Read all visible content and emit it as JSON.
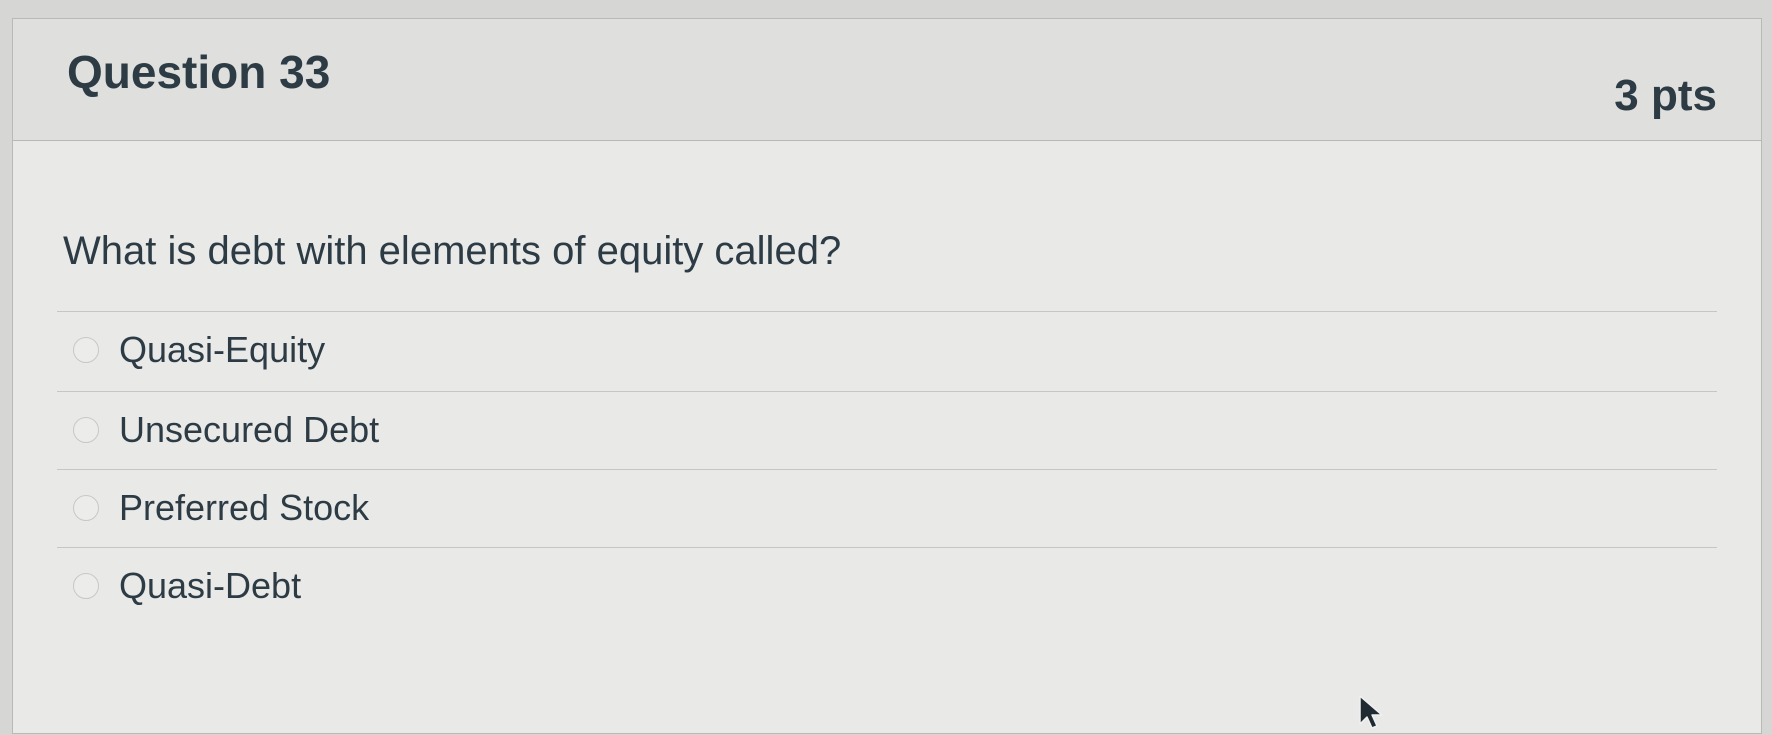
{
  "question": {
    "title": "Question 33",
    "points": "3 pts",
    "text": "What is debt with elements of equity called?"
  },
  "answers": [
    {
      "label": "Quasi-Equity",
      "selected": false
    },
    {
      "label": "Unsecured Debt",
      "selected": false
    },
    {
      "label": "Preferred Stock",
      "selected": false
    },
    {
      "label": "Quasi-Debt",
      "selected": false
    }
  ],
  "colors": {
    "header_bg": "#dfdfde",
    "body_bg": "#e9e9e8",
    "text": "#2d3b45",
    "divider": "#c6c6c5"
  },
  "icons": {
    "answer_radio": "radio-button-icon",
    "cursor": "mouse-pointer-icon"
  }
}
